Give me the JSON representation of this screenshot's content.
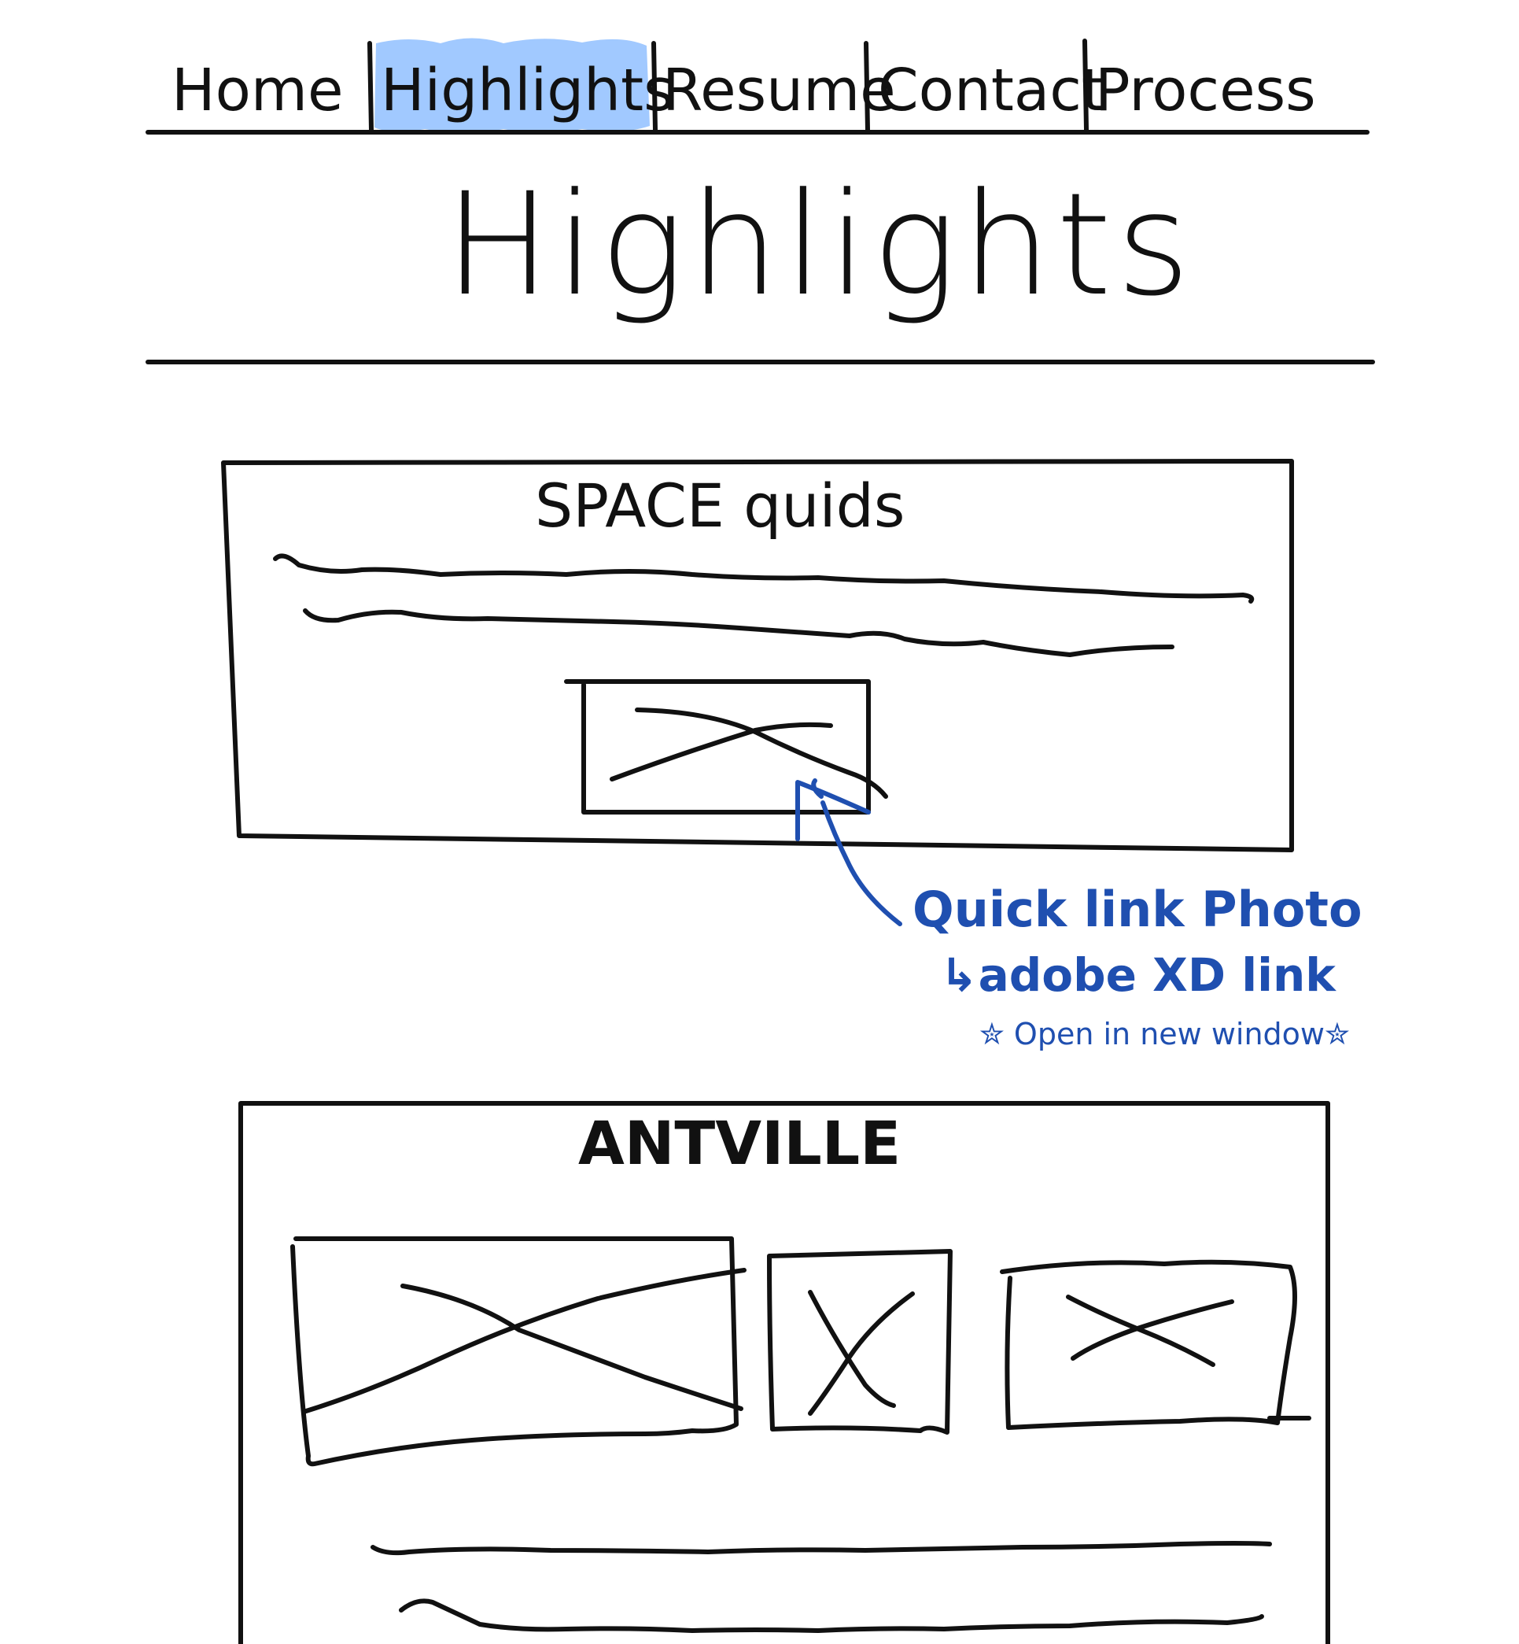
{
  "nav": {
    "items": [
      {
        "label": "Home"
      },
      {
        "label": "Highlights",
        "active": true
      },
      {
        "label": "Resume"
      },
      {
        "label": "Contact"
      },
      {
        "label": "Process"
      }
    ],
    "active_highlight_color": "#9cc6ff"
  },
  "page": {
    "title": "Highlights"
  },
  "cards": [
    {
      "title": "SPACE quids"
    },
    {
      "title": "ANTVILLE"
    }
  ],
  "annotation": {
    "line1": "Quick link Photo",
    "line2": "↳adobe XD link",
    "line3": "✮ Open in new window✮",
    "color": "#1f4fb0"
  },
  "icons": {
    "image_placeholder": "x-box-placeholder-icon",
    "text_lines": "squiggle-text-lines",
    "pointer": "curved-arrow-icon"
  }
}
